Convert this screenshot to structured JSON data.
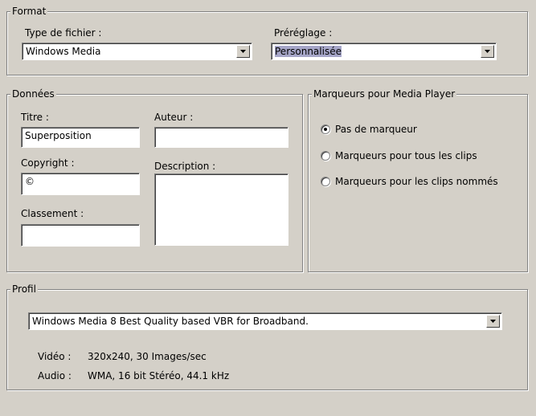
{
  "format": {
    "legend": "Format",
    "file_type_label": "Type de fichier :",
    "file_type_value": "Windows Media",
    "preset_label": "Préréglage :",
    "preset_value": "Personnalisée"
  },
  "data": {
    "legend": "Données",
    "title_label": "Titre :",
    "title_value": "Superposition",
    "author_label": "Auteur :",
    "author_value": "",
    "copyright_label": "Copyright :",
    "copyright_value": "©",
    "description_label": "Description :",
    "description_value": "",
    "rating_label": "Classement :",
    "rating_value": ""
  },
  "markers": {
    "legend": "Marqueurs pour Media Player",
    "options": [
      {
        "label": "Pas de marqueur",
        "selected": true
      },
      {
        "label": "Marqueurs pour tous les clips",
        "selected": false
      },
      {
        "label": "Marqueurs pour les clips nommés",
        "selected": false
      }
    ]
  },
  "profile": {
    "legend": "Profil",
    "value": "Windows Media 8 Best Quality based VBR for Broadband.",
    "video_label": "Vidéo :",
    "video_value": "320x240, 30 Images/sec",
    "audio_label": "Audio :",
    "audio_value": "WMA, 16 bit Stéréo, 44.1 kHz"
  }
}
